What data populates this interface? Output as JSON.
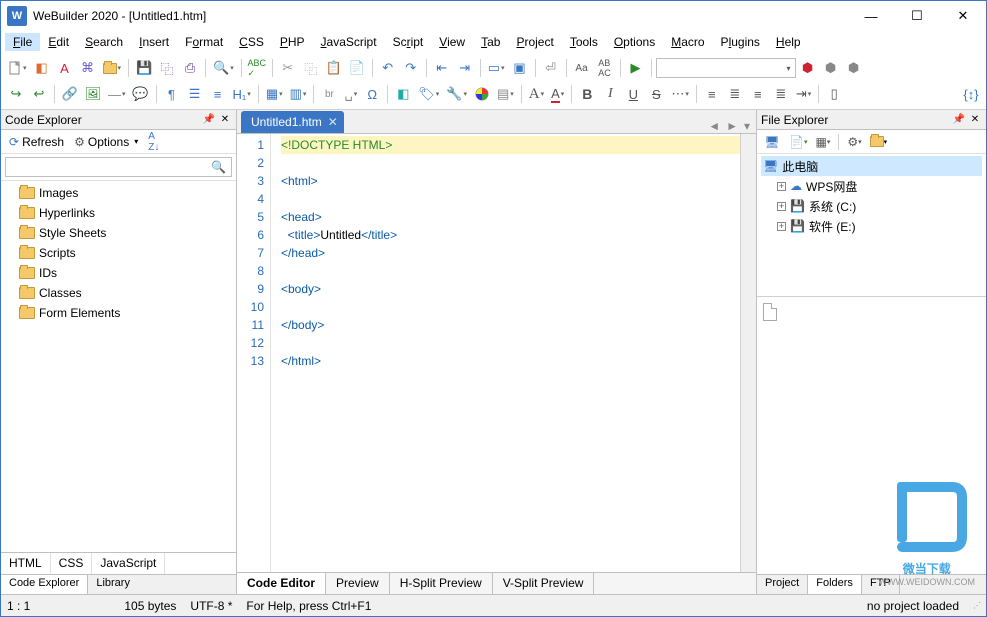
{
  "window": {
    "title": "WeBuilder 2020 - [Untitled1.htm]",
    "app_badge": "W"
  },
  "menu": [
    {
      "label": "File",
      "u": "F"
    },
    {
      "label": "Edit",
      "u": "E"
    },
    {
      "label": "Search",
      "u": "S"
    },
    {
      "label": "Insert",
      "u": "I"
    },
    {
      "label": "Format",
      "u": "o"
    },
    {
      "label": "CSS",
      "u": "C"
    },
    {
      "label": "PHP",
      "u": "P"
    },
    {
      "label": "JavaScript",
      "u": "J"
    },
    {
      "label": "Script",
      "u": "r"
    },
    {
      "label": "View",
      "u": "V"
    },
    {
      "label": "Tab",
      "u": "T"
    },
    {
      "label": "Project",
      "u": "P"
    },
    {
      "label": "Tools",
      "u": "T"
    },
    {
      "label": "Options",
      "u": "O"
    },
    {
      "label": "Macro",
      "u": "M"
    },
    {
      "label": "Plugins",
      "u": "l"
    },
    {
      "label": "Help",
      "u": "H"
    }
  ],
  "code_explorer": {
    "title": "Code Explorer",
    "refresh": "Refresh",
    "options": "Options",
    "items": [
      "Images",
      "Hyperlinks",
      "Style Sheets",
      "Scripts",
      "IDs",
      "Classes",
      "Form Elements"
    ],
    "lang_tabs": [
      "HTML",
      "CSS",
      "JavaScript"
    ],
    "bottom_tabs": [
      "Code Explorer",
      "Library"
    ]
  },
  "editor": {
    "tab": "Untitled1.htm",
    "lines": [
      {
        "n": 1,
        "doctype": "<!DOCTYPE HTML>"
      },
      {
        "n": 2,
        "blank": true
      },
      {
        "n": 3,
        "tag": "<html>"
      },
      {
        "n": 4,
        "blank": true
      },
      {
        "n": 5,
        "tag": "<head>"
      },
      {
        "n": 6,
        "indent": 1,
        "open": "<title>",
        "text": "Untitled",
        "close": "</title>"
      },
      {
        "n": 7,
        "tag": "</head>"
      },
      {
        "n": 8,
        "blank": true
      },
      {
        "n": 9,
        "tag": "<body>"
      },
      {
        "n": 10,
        "blank": true
      },
      {
        "n": 11,
        "tag": "</body>"
      },
      {
        "n": 12,
        "blank": true
      },
      {
        "n": 13,
        "tag": "</html>"
      }
    ],
    "view_tabs": [
      "Code Editor",
      "Preview",
      "H-Split Preview",
      "V-Split Preview"
    ]
  },
  "file_explorer": {
    "title": "File Explorer",
    "root": "此电脑",
    "children": [
      "WPS网盘",
      "系统 (C:)",
      "软件 (E:)"
    ],
    "bottom_tabs": [
      "Project",
      "Folders",
      "FTP"
    ]
  },
  "status": {
    "pos": "1 : 1",
    "size": "105 bytes",
    "enc": "UTF-8 *",
    "help": "For Help, press Ctrl+F1",
    "project": "no project loaded"
  },
  "watermark": {
    "text": "微当下载",
    "sub": "WWW.WEIDOWN.COM"
  }
}
